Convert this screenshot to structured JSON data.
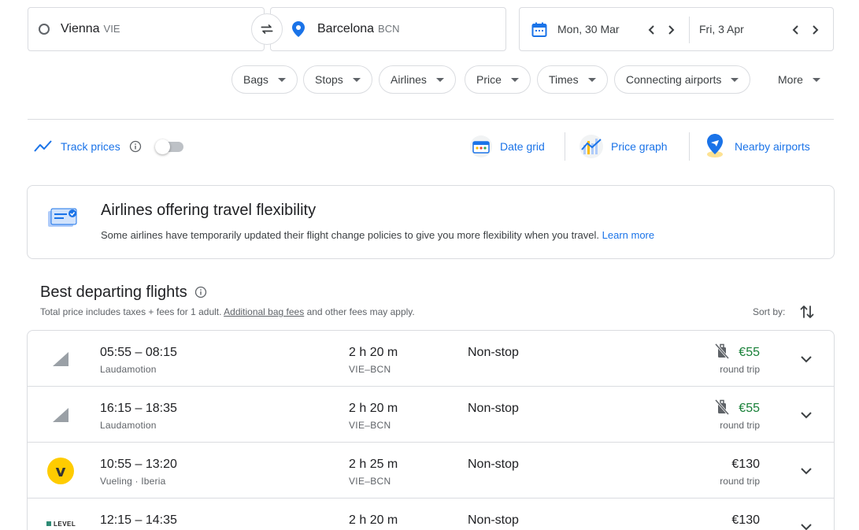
{
  "search": {
    "origin": {
      "city": "Vienna",
      "code": "VIE"
    },
    "destination": {
      "city": "Barcelona",
      "code": "BCN"
    },
    "depart_date": "Mon, 30 Mar",
    "return_date": "Fri, 3 Apr"
  },
  "filters": [
    "Bags",
    "Stops",
    "Airlines",
    "Price",
    "Times",
    "Connecting airports",
    "More"
  ],
  "tools": {
    "track_prices": "Track prices",
    "date_grid": "Date grid",
    "price_graph": "Price graph",
    "nearby_airports": "Nearby airports"
  },
  "notice": {
    "title": "Airlines offering travel flexibility",
    "body": "Some airlines have temporarily updated their flight change policies to give you more flexibility when you travel.",
    "link": "Learn more"
  },
  "results": {
    "title": "Best departing flights",
    "subtitle_prefix": "Total price includes taxes + fees for 1 adult.",
    "subtitle_link": "Additional bag fees",
    "subtitle_suffix": "and other fees may apply.",
    "sort_label": "Sort by:",
    "flights": [
      {
        "times": "05:55 – 08:15",
        "airline": "Laudamotion",
        "duration": "2 h 20 m",
        "route": "VIE–BCN",
        "stops": "Non-stop",
        "price": "€55",
        "trip": "round trip"
      },
      {
        "times": "16:15 – 18:35",
        "airline": "Laudamotion",
        "duration": "2 h 20 m",
        "route": "VIE–BCN",
        "stops": "Non-stop",
        "price": "€55",
        "trip": "round trip"
      },
      {
        "times": "10:55 – 13:20",
        "airline": "Vueling · Iberia",
        "duration": "2 h 25 m",
        "route": "VIE–BCN",
        "stops": "Non-stop",
        "price": "€130",
        "trip": "round trip"
      },
      {
        "times": "12:15 – 14:35",
        "airline": "",
        "duration": "2 h 20 m",
        "route": "",
        "stops": "Non-stop",
        "price": "€130",
        "trip": ""
      }
    ]
  },
  "logos": {
    "level_text": "LEVEL",
    "vueling_letter": "v"
  },
  "colors": {
    "accent": "#1a73e8",
    "price_low": "#188038",
    "border": "#dadce0"
  }
}
